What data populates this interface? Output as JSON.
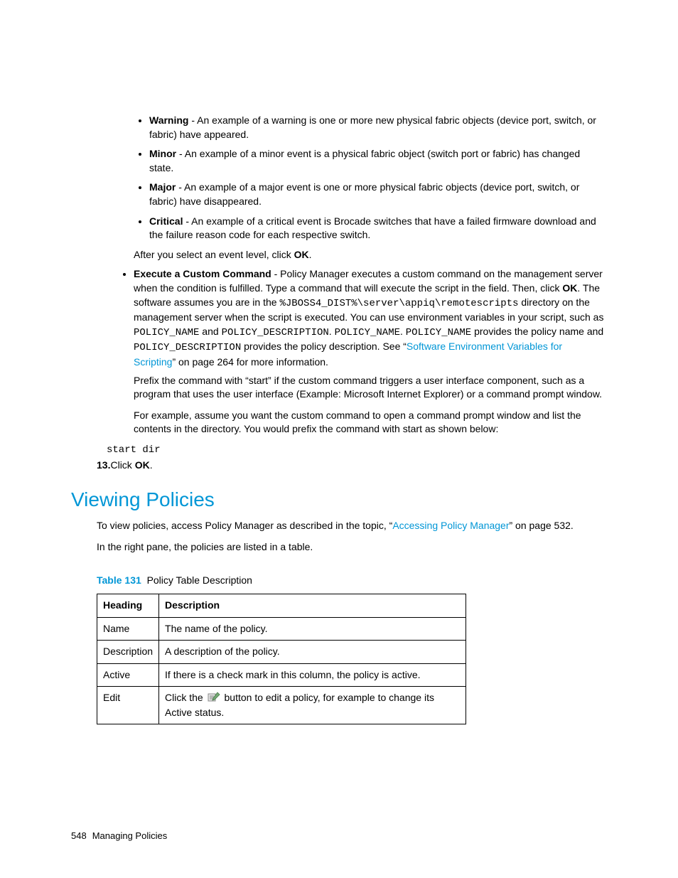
{
  "bullets_inner": [
    {
      "term": "Warning",
      "text": " - An example of a warning is one or more new physical fabric objects (device port, switch, or fabric) have appeared."
    },
    {
      "term": "Minor",
      "text": " - An example of a minor event is a physical fabric object (switch port or fabric) has changed state."
    },
    {
      "term": "Major",
      "text": " - An example of a major event is one or more physical fabric objects (device port, switch, or fabric) have disappeared."
    },
    {
      "term": "Critical",
      "text": " - An example of a critical event is Brocade switches that have a failed firmware download and the failure reason code for each respective switch."
    }
  ],
  "after_select_prefix": "After you select an event level, click ",
  "after_select_bold": "OK",
  "after_select_suffix": ".",
  "execute_item": {
    "term": "Execute a Custom Command",
    "p1a": " - Policy Manager executes a custom command on the management server when the condition is fulfilled. Type a command that will execute the script in the field. Then, click ",
    "p1_ok": "OK",
    "p1b": ". The software assumes you are in the ",
    "code1": "%JBOSS4_DIST%\\server\\appiq\\remotescripts",
    "p1c": " directory on the management server when the script is executed. You can use environment variables in your script, such as ",
    "code2": "POLICY_NAME",
    "p1d": " and ",
    "code3": "POLICY_DESCRIPTION",
    "p1e": ". ",
    "code4": "POLICY_NAME",
    "p1f": ". ",
    "code5": "POLICY_NAME",
    "p1g": " provides the policy name and ",
    "code6": "POLICY_DESCRIPTION",
    "p1h": " provides the policy description. See “",
    "link1": "Software Environment Variables for Scripting",
    "p1i": "” on page 264 for more information.",
    "p2": "Prefix the command with “start” if the custom command triggers a user interface component, such as a program that uses the user interface (Example: Microsoft Internet Explorer) or a command prompt window.",
    "p3": "For example, assume you want the custom command to open a command prompt window and list the contents in the directory. You would prefix the command with start as shown below:"
  },
  "start_dir": "start dir",
  "step13": {
    "num": "13.",
    "pre": "Click ",
    "ok": "OK",
    "post": "."
  },
  "heading": "Viewing Policies",
  "view_p1a": "To view policies, access Policy Manager as described in the topic, “",
  "view_link": "Accessing Policy Manager",
  "view_p1b": "” on page 532.",
  "view_p2": "In the right pane, the policies are listed in a table.",
  "table_caption": {
    "label": "Table 131",
    "text": "Policy Table Description"
  },
  "table": {
    "headers": [
      "Heading",
      "Description"
    ],
    "rows": [
      {
        "h": "Name",
        "d": "The name of the policy."
      },
      {
        "h": "Description",
        "d": "A description of the policy."
      },
      {
        "h": "Active",
        "d": "If there is a check mark in this column, the policy is active."
      },
      {
        "h": "Edit",
        "d_pre": "Click the ",
        "d_post": " button to edit a policy, for example to change its Active status."
      }
    ]
  },
  "footer": {
    "page": "548",
    "title": "Managing Policies"
  }
}
